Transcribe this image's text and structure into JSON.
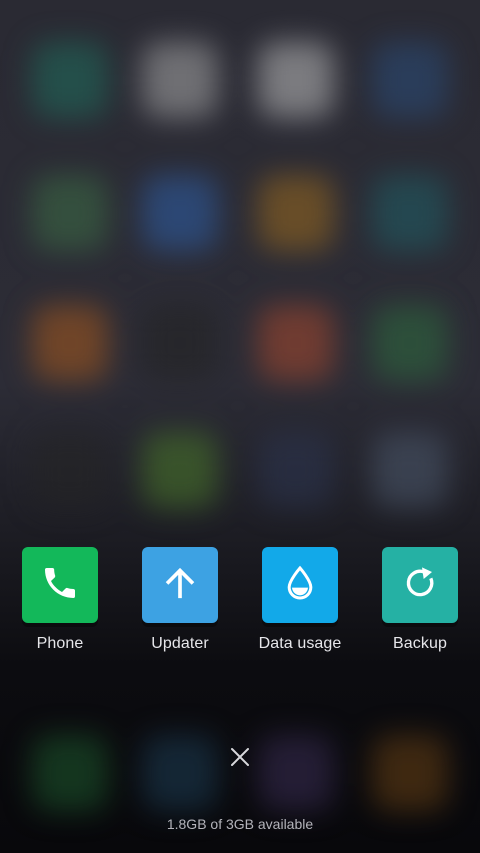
{
  "recent_apps": [
    {
      "label": "Phone",
      "icon": "phone-icon",
      "color": "#13b85a"
    },
    {
      "label": "Updater",
      "icon": "arrow-up-icon",
      "color": "#3da2e3"
    },
    {
      "label": "Data usage",
      "icon": "water-drop-icon",
      "color": "#12a9e9"
    },
    {
      "label": "Backup",
      "icon": "refresh-icon",
      "color": "#25b1a4"
    }
  ],
  "close_all": {
    "icon": "close-icon"
  },
  "memory": {
    "text": "1.8GB of 3GB available"
  },
  "background_blur_colors": [
    "#1f6e5c",
    "#a8a8a8",
    "#bdbdbd",
    "#2a4d7a",
    "#3d6e45",
    "#2e5fa8",
    "#9a6a1e",
    "#1f5f66",
    "#a85a1e",
    "#222222",
    "#a8492e",
    "#2e6b3e",
    "#242424",
    "#4a7a2a",
    "#2b3550",
    "#4d5a6e",
    "#1d5a2e",
    "#1e3e55",
    "#3a2e55",
    "#6a4214"
  ]
}
